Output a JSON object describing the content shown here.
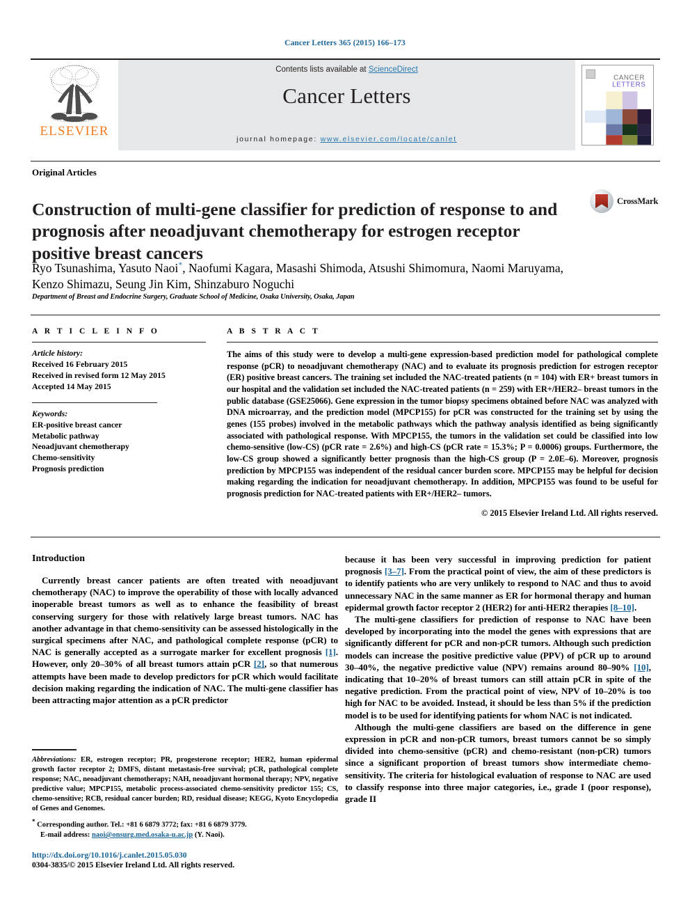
{
  "running_head": "Cancer Letters 365 (2015) 166–173",
  "masthead": {
    "publisher_name": "ELSEVIER",
    "contents_prefix": "Contents lists available at ",
    "contents_link": "ScienceDirect",
    "journal_title": "Cancer Letters",
    "homepage_prefix": "journal homepage: ",
    "homepage_url": "www.elsevier.com/locate/canlet",
    "cover_title_line1": "CANCER",
    "cover_title_line2": "LETTERS"
  },
  "article": {
    "type": "Original Articles",
    "title": "Construction of multi-gene classifier for prediction of response to and prognosis after neoadjuvant chemotherapy for estrogen receptor positive breast cancers",
    "crossmark_label": "CrossMark",
    "authors": "Ryo Tsunashima, Yasuto Naoi ,  Naofumi Kagara, Masashi Shimoda, Atsushi Shimomura, Naomi Maruyama, Kenzo Shimazu, Seung Jin Kim, Shinzaburo Noguchi",
    "authors_part1": "Ryo Tsunashima, Yasuto Naoi",
    "corresponding_marker": "*",
    "authors_part2": ", Naofumi Kagara, Masashi Shimoda, Atsushi Shimomura, Naomi Maruyama, Kenzo Shimazu, Seung Jin Kim, Shinzaburo Noguchi",
    "affiliation": "Department of Breast and Endocrine Surgery, Graduate School of Medicine, Osaka University, Osaka, Japan"
  },
  "article_info": {
    "heading": "A R T I C L E   I N F O",
    "history_label": "Article history:",
    "history": [
      "Received 16 February 2015",
      "Received in revised form 12 May 2015",
      "Accepted 14 May 2015"
    ],
    "keywords_label": "Keywords:",
    "keywords": [
      "ER-positive breast cancer",
      "Metabolic pathway",
      "Neoadjuvant chemotherapy",
      "Chemo-sensitivity",
      "Prognosis prediction"
    ]
  },
  "abstract": {
    "heading": "A B S T R A C T",
    "body": "The aims of this study were to develop a multi-gene expression-based prediction model for pathological complete response (pCR) to neoadjuvant chemotherapy (NAC) and to evaluate its prognosis prediction for estrogen receptor (ER) positive breast cancers. The training set included the NAC-treated patients (n = 104) with ER+ breast tumors in our hospital and the validation set included the NAC-treated patients (n = 259) with ER+/HER2– breast tumors in the public database (GSE25066). Gene expression in the tumor biopsy specimens obtained before NAC was analyzed with DNA microarray, and the prediction model (MPCP155) for pCR was constructed for the training set by using the genes (155 probes) involved in the metabolic pathways which the pathway analysis identified as being significantly associated with pathological response. With MPCP155, the tumors in the validation set could be classified into low chemo-sensitive (low-CS) (pCR rate = 2.6%) and high-CS (pCR rate = 15.3%; P = 0.0006) groups. Furthermore, the low-CS group showed a significantly better prognosis than the high-CS group (P = 2.0E–6). Moreover, prognosis prediction by MPCP155 was independent of the residual cancer burden score. MPCP155 may be helpful for decision making regarding the indication for neoadjuvant chemotherapy. In addition, MPCP155 was found to be useful for prognosis prediction for NAC-treated patients with ER+/HER2– tumors.",
    "copyright": "© 2015 Elsevier Ireland Ltd. All rights reserved."
  },
  "introduction": {
    "heading": "Introduction",
    "left_para1_a": "Currently breast cancer patients are often treated with neoadjuvant chemotherapy (NAC) to improve the operability of those with locally advanced inoperable breast tumors as well as to enhance the feasibility of breast conserving surgery for those with relatively large breast tumors. NAC has another advantage in that chemo-sensitivity can be assessed histologically in the surgical specimens after NAC, and pathological complete response (pCR) to NAC is generally accepted as a surrogate marker for excellent prognosis ",
    "ref1": "[1]",
    "left_para1_b": ". However, only 20–30% of all breast tumors attain pCR ",
    "ref2": "[2]",
    "left_para1_c": ", so that numerous attempts have been made to develop predictors for pCR which would facilitate decision making regarding the indication of NAC. The multi-gene classifier has been attracting major attention as a pCR predictor",
    "right_para1_a": "because it has been very successful in improving prediction for patient prognosis ",
    "ref3": "[3–7]",
    "right_para1_b": ". From the practical point of view, the aim of these predictors is to identify patients who are very unlikely to respond to NAC and thus to avoid unnecessary NAC in the same manner as ER for hormonal therapy and human epidermal growth factor receptor 2 (HER2) for anti-HER2 therapies ",
    "ref4": "[8–10]",
    "right_para1_c": ".",
    "right_para2_a": "The multi-gene classifiers for prediction of response to NAC have been developed by incorporating into the model the genes with expressions that are significantly different for pCR and non-pCR tumors. Although such prediction models can increase the positive predictive value (PPV) of pCR up to around 30–40%, the negative predictive value (NPV) remains around 80–90% ",
    "ref5": "[10]",
    "right_para2_b": ", indicating that 10–20% of breast tumors can still attain pCR in spite of the negative prediction. From the practical point of view, NPV of 10–20% is too high for NAC to be avoided. Instead, it should be less than 5% if the prediction model is to be used for identifying patients for whom NAC is not indicated.",
    "right_para3": "Although the multi-gene classifiers are based on the difference in gene expression in pCR and non-pCR tumors, breast tumors cannot be so simply divided into chemo-sensitive (pCR) and chemo-resistant (non-pCR) tumors since a significant proportion of breast tumors show intermediate chemo-sensitivity. The criteria for histological evaluation of response to NAC are used to classify response into three major categories, i.e., grade I (poor response), grade II"
  },
  "footnotes": {
    "abbrev_label": "Abbreviations:",
    "abbrev_text": " ER, estrogen receptor; PR, progesterone receptor; HER2, human epidermal growth factor receptor 2; DMFS, distant metastasis-free survival; pCR, pathological complete response; NAC, neoadjuvant chemotherapy; NAH, neoadjuvant hormonal therapy; NPV, negative predictive value; MPCP155, metabolic process-associated chemo-sensitivity predictor 155; CS, chemo-sensitive; RCB, residual cancer burden; RD, residual disease; KEGG, Kyoto Encyclopedia of Genes and Genomes.",
    "corresponding_marker": "*",
    "corresponding_text": " Corresponding author. Tel.: +81 6 6879 3772; fax: +81 6 6879 3779.",
    "email_label": "E-mail address:",
    "email": "naoi@onsurg.med.osaka-u.ac.jp",
    "email_suffix": " (Y. Naoi)."
  },
  "footer": {
    "doi": "http://dx.doi.org/10.1016/j.canlet.2015.05.030",
    "issn_line": "0304-3835/© 2015 Elsevier Ireland Ltd. All rights reserved."
  },
  "colors": {
    "link_blue": "#1a6496",
    "elsevier_orange": "#f47c20",
    "banner_gray": "#e6e7e8"
  }
}
